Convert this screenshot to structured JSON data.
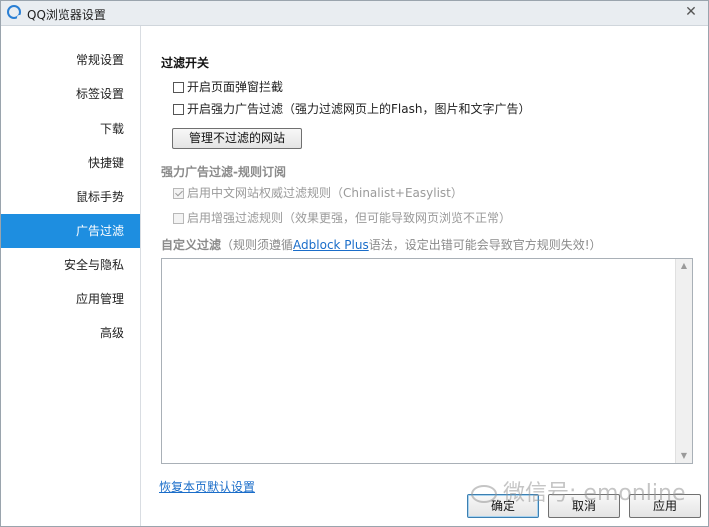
{
  "window": {
    "title": "QQ浏览器设置",
    "close_glyph": "✕"
  },
  "sidebar": {
    "items": [
      {
        "label": "常规设置",
        "active": false
      },
      {
        "label": "标签设置",
        "active": false
      },
      {
        "label": "下载",
        "active": false
      },
      {
        "label": "快捷键",
        "active": false
      },
      {
        "label": "鼠标手势",
        "active": false
      },
      {
        "label": "广告过滤",
        "active": true
      },
      {
        "label": "安全与隐私",
        "active": false
      },
      {
        "label": "应用管理",
        "active": false
      },
      {
        "label": "高级",
        "active": false
      }
    ]
  },
  "filter_switch": {
    "title": "过滤开关",
    "popup_block": {
      "label": "开启页面弹窗拦截",
      "checked": false
    },
    "strong_ad": {
      "label": "开启强力广告过滤（强力过滤网页上的Flash，图片和文字广告）",
      "checked": false
    },
    "manage_button": "管理不过滤的网站"
  },
  "subscription": {
    "title": "强力广告过滤-规则订阅",
    "cn_rules": {
      "label": "启用中文网站权威过滤规则（Chinalist+Easylist）",
      "checked": true,
      "disabled": true
    },
    "enhanced_rules": {
      "label": "启用增强过滤规则（效果更强，但可能导致网页浏览不正常）",
      "checked": false,
      "disabled": true
    }
  },
  "custom_filter": {
    "title": "自定义过滤",
    "hint_prefix": "（规则须遵循",
    "hint_link": "Adblock Plus",
    "hint_suffix": "语法，设定出错可能会导致官方规则失效!）",
    "value": ""
  },
  "footer": {
    "reset_link": "恢复本页默认设置",
    "ok_label": "确定",
    "cancel_label": "取消",
    "apply_label": "应用"
  },
  "watermark": {
    "text": "微信号: emonline"
  },
  "icons": {
    "app": "qq-browser-logo-icon",
    "close": "close-icon",
    "scroll_up": "scroll-up-arrow-icon",
    "scroll_down": "scroll-down-arrow-icon"
  },
  "colors": {
    "accent": "#1e8ee0",
    "link": "#1a6dc9",
    "titlebar": "#e9edf1"
  }
}
